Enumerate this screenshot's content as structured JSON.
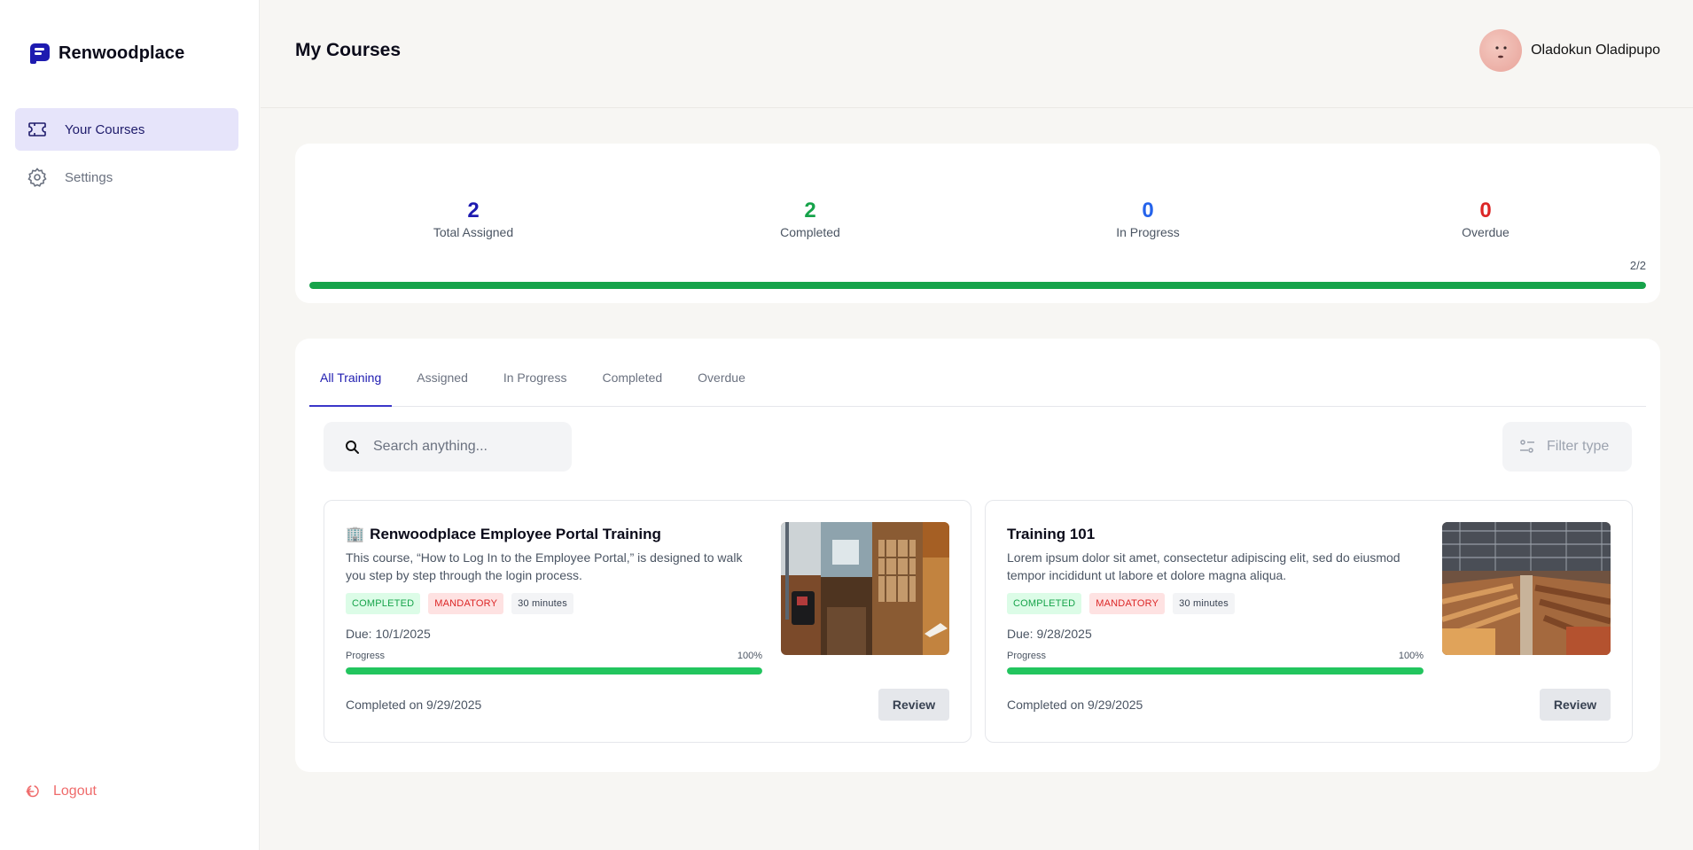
{
  "brand": {
    "name": "Renwoodplace"
  },
  "sidebar": {
    "items": [
      {
        "label": "Your Courses",
        "icon": "ticket-icon",
        "active": true
      },
      {
        "label": "Settings",
        "icon": "gear-icon",
        "active": false
      }
    ],
    "logout_label": "Logout"
  },
  "header": {
    "title": "My Courses",
    "user_name": "Oladokun Oladipupo"
  },
  "stats": {
    "total_assigned": {
      "value": "2",
      "label": "Total Assigned",
      "color": "#1e1bb0"
    },
    "completed": {
      "value": "2",
      "label": "Completed",
      "color": "#16a34a"
    },
    "in_progress": {
      "value": "0",
      "label": "In Progress",
      "color": "#2563eb"
    },
    "overdue": {
      "value": "0",
      "label": "Overdue",
      "color": "#dc2626"
    },
    "overall_count": "2/2",
    "overall_progress_fraction": 1.0
  },
  "tabs": [
    "All Training",
    "Assigned",
    "In Progress",
    "Completed",
    "Overdue"
  ],
  "active_tab": "All Training",
  "search": {
    "placeholder": "Search anything..."
  },
  "filter": {
    "label": "Filter type"
  },
  "courses": [
    {
      "emoji": "🏢",
      "title": "Renwoodplace Employee Portal Training",
      "description": "This course, “How to Log In to the Employee Portal,” is designed to walk you step by step through the login process.",
      "status_badge": "COMPLETED",
      "mandatory_badge": "MANDATORY",
      "duration": "30 minutes",
      "due": "Due: 10/1/2025",
      "progress_label": "Progress",
      "progress_pct": "100%",
      "progress_fraction": 1.0,
      "completed_on": "Completed on 9/29/2025",
      "button_label": "Review"
    },
    {
      "emoji": "",
      "title": "Training 101",
      "description": "Lorem ipsum dolor sit amet, consectetur adipiscing elit, sed do eiusmod tempor incididunt ut labore et dolore magna aliqua.",
      "status_badge": "COMPLETED",
      "mandatory_badge": "MANDATORY",
      "duration": "30 minutes",
      "due": "Due: 9/28/2025",
      "progress_label": "Progress",
      "progress_pct": "100%",
      "progress_fraction": 1.0,
      "completed_on": "Completed on 9/29/2025",
      "button_label": "Review"
    }
  ]
}
